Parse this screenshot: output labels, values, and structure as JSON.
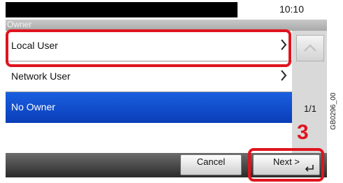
{
  "header": {
    "time": "10:10"
  },
  "section": {
    "title": "Owner"
  },
  "list": {
    "items": [
      {
        "label": "Local User"
      },
      {
        "label": "Network User"
      },
      {
        "label": "No Owner"
      }
    ]
  },
  "pager": {
    "page": "1/1"
  },
  "footer": {
    "cancel_label": "Cancel",
    "next_label": "Next >"
  },
  "annotation": {
    "step_number": "3",
    "figure_code": "GB0296_00"
  },
  "colors": {
    "selection": "#1a5fe0",
    "callout": "#e0141e"
  },
  "icons": {
    "chevron": "chevron-right-icon",
    "scroll_up": "scroll-up-icon",
    "enter": "enter-icon"
  }
}
